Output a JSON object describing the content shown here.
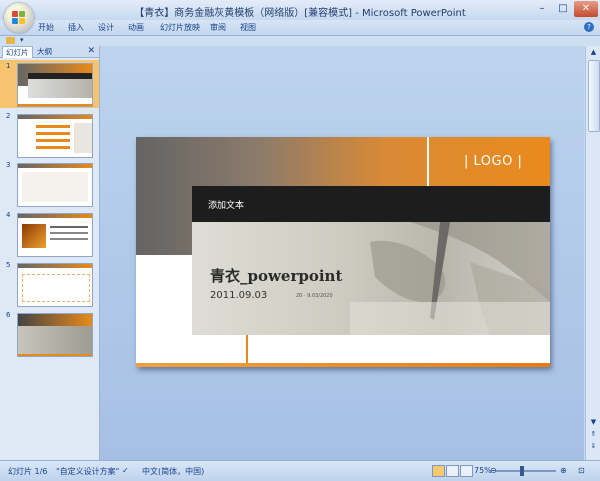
{
  "window": {
    "title": "【青衣】商务金融灰黄模板（网络版）[兼容模式] - Microsoft PowerPoint",
    "controls": [
      "–",
      "□",
      "✕"
    ]
  },
  "ribbon": {
    "tabs": [
      "开始",
      "插入",
      "设计",
      "动画",
      "幻灯片放映",
      "审阅",
      "视图"
    ],
    "help": "?"
  },
  "left_pane": {
    "tabs": [
      "幻灯片",
      "大纲"
    ],
    "close": "✕",
    "slide_numbers": [
      "1",
      "2",
      "3",
      "4",
      "5",
      "6"
    ]
  },
  "slide": {
    "logo": "| LOGO |",
    "add_text": "添加文本",
    "title": "青衣_powerpoint",
    "date": "2011.09.03",
    "date_small": "20 · 9.03/2020"
  },
  "status": {
    "slide_count": "幻灯片 1/6",
    "theme": "\"自定义设计方案\"",
    "language": "中文(简体，中国)",
    "zoom": "75%"
  },
  "colors": {
    "accent_orange": "#e88a1a",
    "selected_thumb": "#f6c36e",
    "ribbon_text": "#15428b"
  }
}
